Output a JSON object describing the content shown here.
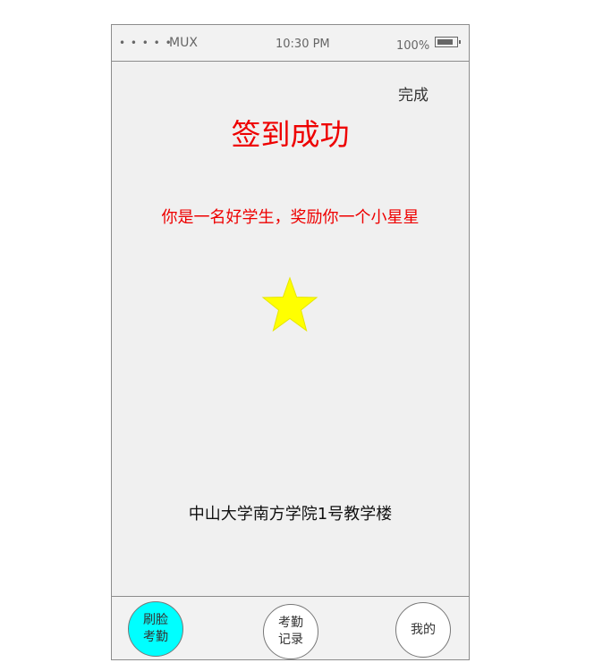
{
  "status_bar": {
    "signal": "• • • • •",
    "carrier": "MUX",
    "time": "10:30 PM",
    "battery_percent": "100%",
    "battery_icon": "battery-icon"
  },
  "header": {
    "done_label": "完成"
  },
  "main": {
    "title": "签到成功",
    "message": "你是一名好学生，奖励你一个小星星",
    "reward_icon": "star-icon",
    "star_color": "#ffff00",
    "location": "中山大学南方学院1号教学楼"
  },
  "tabbar": {
    "tabs": [
      {
        "label": "刷脸考勤",
        "active": true
      },
      {
        "label": "考勤记录",
        "active": false
      },
      {
        "label": "我的",
        "active": false
      }
    ],
    "active_color": "#00ffff"
  },
  "colors": {
    "accent": "#ee0000",
    "background": "#f0f0f0"
  }
}
